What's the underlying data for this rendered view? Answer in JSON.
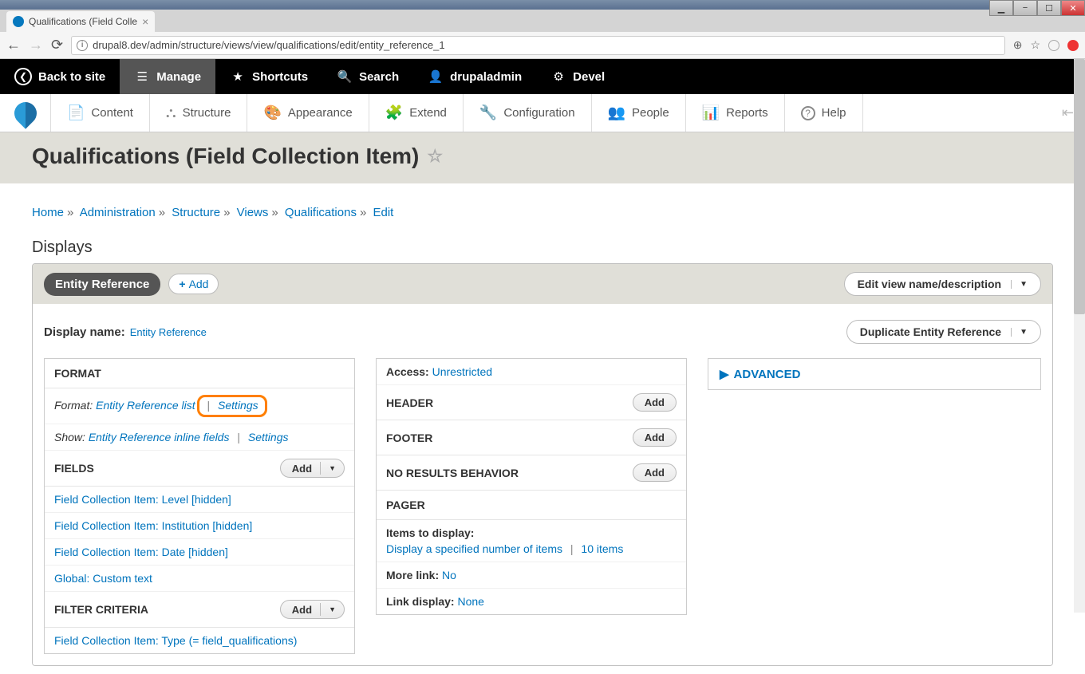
{
  "browser": {
    "tab_title": "Qualifications (Field Colle",
    "url": "drupal8.dev/admin/structure/views/view/qualifications/edit/entity_reference_1"
  },
  "toolbar": {
    "back": "Back to site",
    "manage": "Manage",
    "shortcuts": "Shortcuts",
    "search": "Search",
    "user": "drupaladmin",
    "devel": "Devel"
  },
  "admin_menu": {
    "content": "Content",
    "structure": "Structure",
    "appearance": "Appearance",
    "extend": "Extend",
    "configuration": "Configuration",
    "people": "People",
    "reports": "Reports",
    "help": "Help"
  },
  "page_title": "Qualifications (Field Collection Item)",
  "breadcrumb": {
    "home": "Home",
    "admin": "Administration",
    "structure": "Structure",
    "views": "Views",
    "qual": "Qualifications",
    "edit": "Edit"
  },
  "displays": {
    "heading": "Displays",
    "active": "Entity Reference",
    "add": "Add",
    "edit_desc": "Edit view name/description",
    "display_name_label": "Display name:",
    "display_name_value": "Entity Reference",
    "duplicate": "Duplicate Entity Reference"
  },
  "col1": {
    "format_h": "FORMAT",
    "format_label": "Format:",
    "format_value": "Entity Reference list",
    "settings": "Settings",
    "show_label": "Show:",
    "show_value": "Entity Reference inline fields",
    "fields_h": "FIELDS",
    "add": "Add",
    "field1": "Field Collection Item: Level [hidden]",
    "field2": "Field Collection Item: Institution [hidden]",
    "field3": "Field Collection Item: Date [hidden]",
    "field4": "Global: Custom text",
    "filter_h": "FILTER CRITERIA",
    "filter1": "Field Collection Item: Type (= field_qualifications)"
  },
  "col2": {
    "access_label": "Access:",
    "access_value": "Unrestricted",
    "header_h": "HEADER",
    "footer_h": "FOOTER",
    "noresults_h": "NO RESULTS BEHAVIOR",
    "pager_h": "PAGER",
    "items_label": "Items to display:",
    "items_value": "Display a specified number of items",
    "items_count": "10 items",
    "more_label": "More link:",
    "more_value": "No",
    "linkdisp_label": "Link display:",
    "linkdisp_value": "None",
    "add": "Add"
  },
  "col3": {
    "advanced": "ADVANCED"
  }
}
